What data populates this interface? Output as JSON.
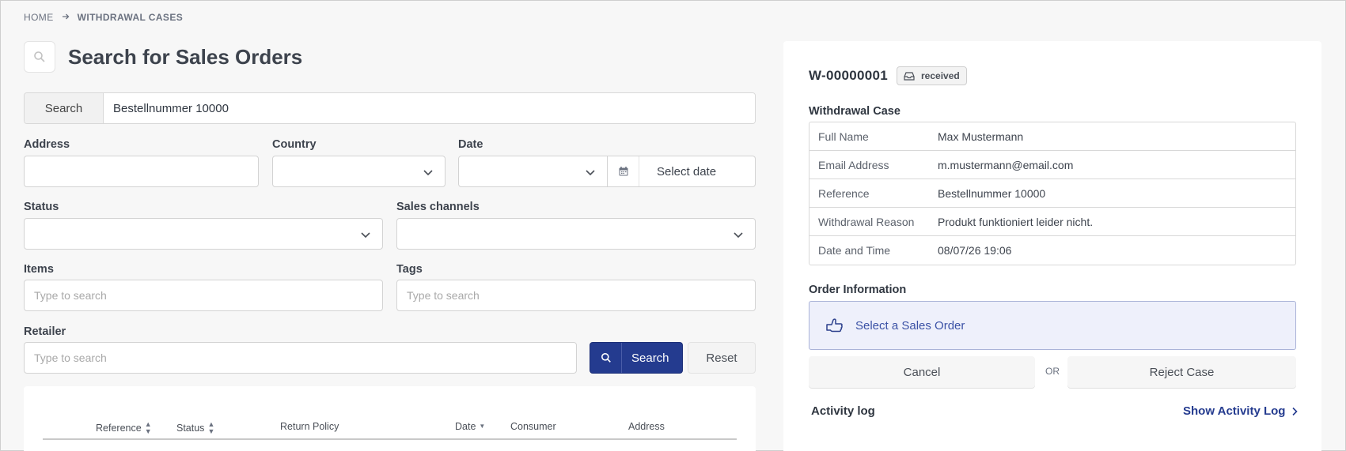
{
  "breadcrumb": {
    "home": "HOME",
    "current": "WITHDRAWAL CASES"
  },
  "page": {
    "title": "Search for Sales Orders"
  },
  "search": {
    "addon_label": "Search",
    "value": "Bestellnummer 10000"
  },
  "filters": {
    "address": {
      "label": "Address",
      "value": ""
    },
    "country": {
      "label": "Country",
      "value": ""
    },
    "date": {
      "label": "Date",
      "value": "",
      "select_label": "Select date"
    },
    "status": {
      "label": "Status",
      "value": ""
    },
    "sales_channels": {
      "label": "Sales channels",
      "value": ""
    },
    "items": {
      "label": "Items",
      "placeholder": "Type to search"
    },
    "tags": {
      "label": "Tags",
      "placeholder": "Type to search"
    },
    "retailer": {
      "label": "Retailer",
      "placeholder": "Type to search"
    }
  },
  "actions": {
    "search_label": "Search",
    "reset_label": "Reset"
  },
  "table": {
    "columns": [
      {
        "label": "Reference",
        "sortable": true
      },
      {
        "label": "Status",
        "sortable": true
      },
      {
        "label": "Return Policy",
        "sortable": false
      },
      {
        "label": "Date",
        "sortable": true
      },
      {
        "label": "Consumer",
        "sortable": false
      },
      {
        "label": "Address",
        "sortable": false
      }
    ]
  },
  "case": {
    "id": "W-00000001",
    "status_badge": "received",
    "section_title": "Withdrawal Case",
    "fields": [
      {
        "key": "Full Name",
        "value": "Max Mustermann"
      },
      {
        "key": "Email Address",
        "value": "m.mustermann@email.com"
      },
      {
        "key": "Reference",
        "value": "Bestellnummer 10000"
      },
      {
        "key": "Withdrawal Reason",
        "value": "Produkt funktioniert leider nicht."
      },
      {
        "key": "Date and Time",
        "value": "08/07/26 19:06"
      }
    ],
    "order_section_title": "Order Information",
    "select_order_label": "Select a Sales Order",
    "cancel_label": "Cancel",
    "or_label": "OR",
    "reject_label": "Reject Case",
    "activity_label": "Activity log",
    "activity_link": "Show Activity Log"
  },
  "colors": {
    "primary": "#243b8f",
    "order_box_bg": "#eef0fb",
    "link": "#3b52a6"
  },
  "icons": {
    "title": "search-icon",
    "date": "calendar-icon",
    "search_button": "search-icon",
    "badge": "inbox-icon",
    "order": "hand-pointer-icon",
    "activity": "chevron-right-icon",
    "breadcrumb_separator": "arrow-right-icon",
    "dropdown": "chevron-down-icon"
  }
}
